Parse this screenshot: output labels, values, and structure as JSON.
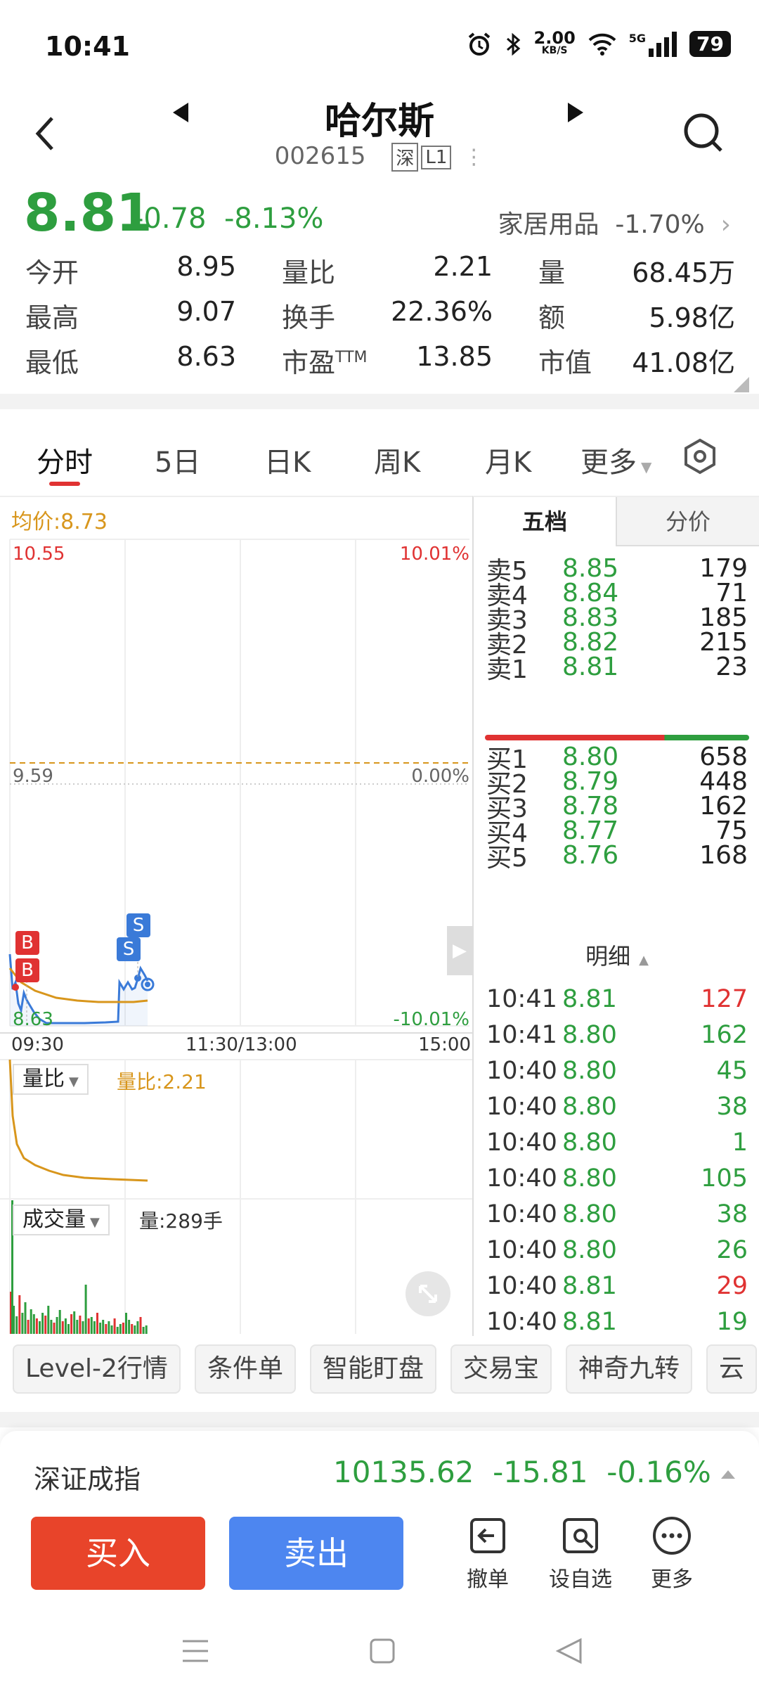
{
  "status": {
    "time": "10:41",
    "net_speed": "2.00",
    "net_unit": "KB/S",
    "network": "5G",
    "battery": "79"
  },
  "header": {
    "stock_name": "哈尔斯",
    "stock_code": "002615",
    "market_tag": "深",
    "level_tag": "L1"
  },
  "quote": {
    "price": "8.81",
    "change": "-0.78",
    "change_pct": "-8.13%",
    "sector": "家居用品",
    "sector_pct": "-1.70%",
    "rows": [
      [
        {
          "k": "今开",
          "v": "8.95",
          "c": "green"
        },
        {
          "k": "量比",
          "v": "2.21",
          "c": ""
        },
        {
          "k": "量",
          "v": "68.45万",
          "c": ""
        }
      ],
      [
        {
          "k": "最高",
          "v": "9.07",
          "c": "green"
        },
        {
          "k": "换手",
          "v": "22.36%",
          "c": ""
        },
        {
          "k": "额",
          "v": "5.98亿",
          "c": ""
        }
      ],
      [
        {
          "k": "最低",
          "v": "8.63",
          "c": "green"
        },
        {
          "k": "市盈",
          "sup": "TTM",
          "v": "13.85",
          "c": ""
        },
        {
          "k": "市值",
          "v": "41.08亿",
          "c": ""
        }
      ]
    ]
  },
  "tabs": [
    "分时",
    "5日",
    "日K",
    "周K",
    "月K",
    "更多"
  ],
  "chart": {
    "avg_label": "均价:8.73",
    "top_left": "10.55",
    "top_right": "10.01%",
    "mid_left": "9.59",
    "mid_right": "0.00%",
    "bot_left": "8.63",
    "bot_right": "-10.01%",
    "time_start": "09:30",
    "time_mid": "11:30/13:00",
    "time_end": "15:00",
    "ratio_selector": "量比",
    "ratio_value": "量比:2.21",
    "vol_selector": "成交量",
    "vol_value": "量:289手",
    "marker_b": "B",
    "marker_s": "S"
  },
  "orderbook": {
    "tab_active": "五档",
    "tab_other": "分价",
    "asks": [
      {
        "lbl": "卖5",
        "p": "8.85",
        "v": "179"
      },
      {
        "lbl": "卖4",
        "p": "8.84",
        "v": "71"
      },
      {
        "lbl": "卖3",
        "p": "8.83",
        "v": "185"
      },
      {
        "lbl": "卖2",
        "p": "8.82",
        "v": "215"
      },
      {
        "lbl": "卖1",
        "p": "8.81",
        "v": "23"
      }
    ],
    "bids": [
      {
        "lbl": "买1",
        "p": "8.80",
        "v": "658"
      },
      {
        "lbl": "买2",
        "p": "8.79",
        "v": "448"
      },
      {
        "lbl": "买3",
        "p": "8.78",
        "v": "162"
      },
      {
        "lbl": "买4",
        "p": "8.77",
        "v": "75"
      },
      {
        "lbl": "买5",
        "p": "8.76",
        "v": "168"
      }
    ],
    "detail_label": "明细",
    "ticks": [
      {
        "t": "10:41",
        "p": "8.81",
        "v": "127",
        "c": "red"
      },
      {
        "t": "10:41",
        "p": "8.80",
        "v": "162",
        "c": "green"
      },
      {
        "t": "10:40",
        "p": "8.80",
        "v": "45",
        "c": "green"
      },
      {
        "t": "10:40",
        "p": "8.80",
        "v": "38",
        "c": "green"
      },
      {
        "t": "10:40",
        "p": "8.80",
        "v": "1",
        "c": "green"
      },
      {
        "t": "10:40",
        "p": "8.80",
        "v": "105",
        "c": "green"
      },
      {
        "t": "10:40",
        "p": "8.80",
        "v": "38",
        "c": "green"
      },
      {
        "t": "10:40",
        "p": "8.80",
        "v": "26",
        "c": "green"
      },
      {
        "t": "10:40",
        "p": "8.81",
        "v": "29",
        "c": "red"
      },
      {
        "t": "10:40",
        "p": "8.81",
        "v": "19",
        "c": "green"
      }
    ]
  },
  "features": [
    "Level-2行情",
    "条件单",
    "智能盯盘",
    "交易宝",
    "神奇九转",
    "云"
  ],
  "index": {
    "name": "深证成指",
    "value": "10135.62",
    "change": "-15.81",
    "pct": "-0.16%"
  },
  "actions": {
    "buy": "买入",
    "sell": "卖出",
    "cancel": "撤单",
    "watch": "设自选",
    "more": "更多"
  },
  "colors": {
    "green": "#2e9e3f",
    "red": "#e03232",
    "buy": "#e8442a",
    "sell": "#4d86f0",
    "avg": "#d8961c"
  }
}
